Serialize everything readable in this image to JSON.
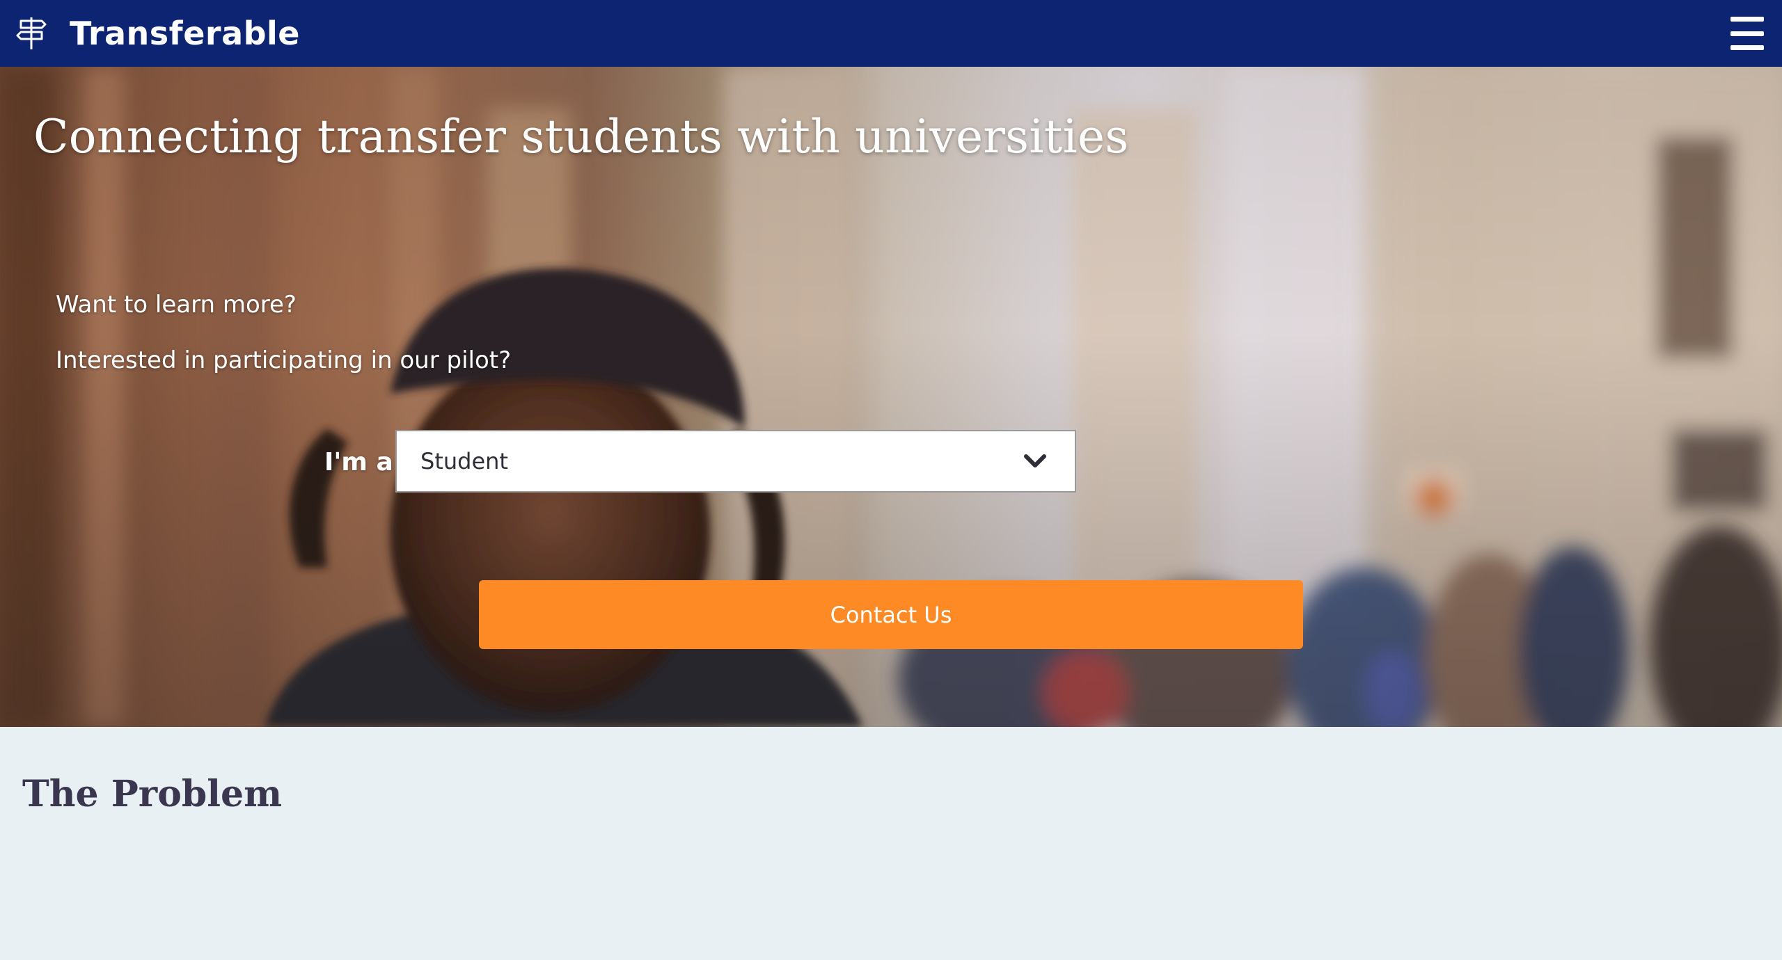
{
  "header": {
    "brand_name": "Transferable",
    "logo_icon": "signpost-icon",
    "menu_icon": "hamburger-menu-icon",
    "background_color": "#0c2471"
  },
  "hero": {
    "title": "Connecting transfer students with universities",
    "line_1": "Want to learn more?",
    "line_2": "Interested in participating in our pilot?",
    "role_label": "I'm a",
    "role_select": {
      "selected": "Student",
      "icon": "chevron-down-icon"
    },
    "cta_label": "Contact Us",
    "cta_color": "#fd8a25"
  },
  "problem_section": {
    "title": "The Problem"
  }
}
